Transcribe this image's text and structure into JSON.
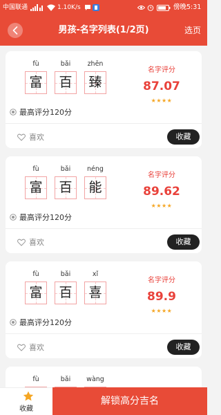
{
  "status_bar": {
    "carrier": "中国联通",
    "net_speed": "1.10K/s",
    "time": "傍晚5:31",
    "icons": [
      "signal-icon",
      "wifi-icon",
      "message-icon",
      "app-badge-icon",
      "eye-icon",
      "alarm-icon",
      "battery-icon"
    ]
  },
  "header": {
    "back_icon": "back-icon",
    "title": "男孩-名字列表(1/2页)",
    "select_page": "选页"
  },
  "card_icons": {
    "max_score": "target-icon",
    "like": "heart-icon",
    "rating": "star-icon"
  },
  "names": [
    {
      "chars": [
        {
          "pinyin": "fù",
          "char": "富"
        },
        {
          "pinyin": "bǎi",
          "char": "百"
        },
        {
          "pinyin": "zhēn",
          "char": "臻"
        }
      ],
      "score_label": "名字评分",
      "score": "87.07",
      "stars": 4,
      "max_score_text": "最高评分120分",
      "like_label": "喜欢",
      "collect_label": "收藏"
    },
    {
      "chars": [
        {
          "pinyin": "fù",
          "char": "富"
        },
        {
          "pinyin": "bǎi",
          "char": "百"
        },
        {
          "pinyin": "néng",
          "char": "能"
        }
      ],
      "score_label": "名字评分",
      "score": "89.62",
      "stars": 4,
      "max_score_text": "最高评分120分",
      "like_label": "喜欢",
      "collect_label": "收藏"
    },
    {
      "chars": [
        {
          "pinyin": "fù",
          "char": "富"
        },
        {
          "pinyin": "bǎi",
          "char": "百"
        },
        {
          "pinyin": "xǐ",
          "char": "喜"
        }
      ],
      "score_label": "名字评分",
      "score": "89.9",
      "stars": 4,
      "max_score_text": "最高评分120分",
      "like_label": "喜欢",
      "collect_label": "收藏"
    },
    {
      "chars": [
        {
          "pinyin": "fù"
        },
        {
          "pinyin": "bǎi"
        },
        {
          "pinyin": "wàng"
        }
      ]
    }
  ],
  "bottom_bar": {
    "favorites_icon": "star-icon",
    "favorites_label": "收藏",
    "unlock_label": "解锁高分吉名"
  },
  "colors": {
    "primary": "#e84b37",
    "score": "#e9423b",
    "star": "#f5a623",
    "button_dark": "#222222",
    "background": "#f3f3f3"
  }
}
